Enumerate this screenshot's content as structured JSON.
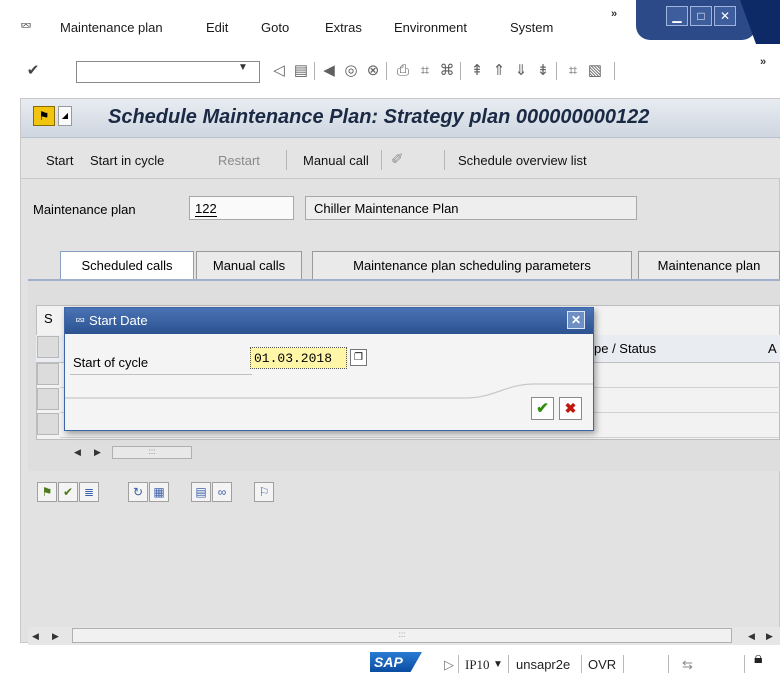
{
  "menubar": {
    "items": [
      {
        "label": "Maintenance plan"
      },
      {
        "label": "Edit"
      },
      {
        "label": "Goto"
      },
      {
        "label": "Extras"
      },
      {
        "label": "Environment"
      },
      {
        "label": "System"
      }
    ],
    "overflow_label": "»"
  },
  "toolbar": {
    "command_field_value": "",
    "overflow_label": "»"
  },
  "window": {
    "title": "Schedule Maintenance Plan: Strategy plan 000000000122"
  },
  "appbar": {
    "start": "Start",
    "start_in_cycle": "Start in cycle",
    "restart": "Restart",
    "manual_call": "Manual call",
    "schedule_overview": "Schedule overview list"
  },
  "header": {
    "plan_label": "Maintenance plan",
    "plan_value": "122",
    "plan_description": "Chiller Maintenance Plan"
  },
  "tabs": [
    {
      "label": "Scheduled calls"
    },
    {
      "label": "Manual calls"
    },
    {
      "label": "Maintenance plan scheduling parameters"
    },
    {
      "label": "Maintenance plan"
    }
  ],
  "grid": {
    "first_col_partial": "S",
    "status_header": "pe / Status",
    "next_header_partial": "A"
  },
  "dialog": {
    "title": "Start Date",
    "field_label": "Start of cycle",
    "field_value": "01.03.2018"
  },
  "statusbar": {
    "logo": "SAP",
    "system": "IP10",
    "server": "unsapr2e",
    "mode": "OVR"
  }
}
